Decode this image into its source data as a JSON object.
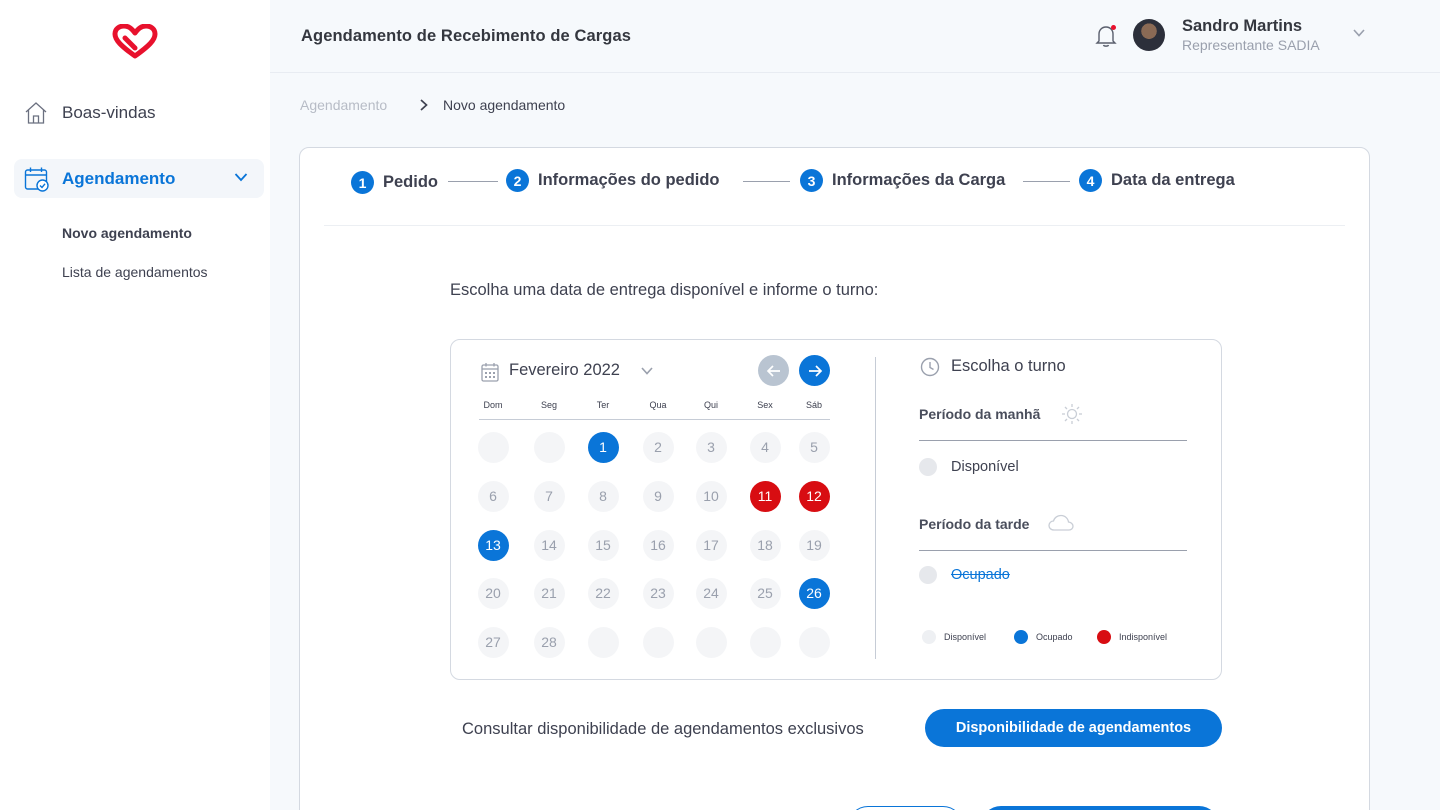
{
  "header": {
    "title": "Agendamento de Recebimento de Cargas",
    "user_name": "Sandro Martins",
    "user_role": "Representante SADIA"
  },
  "sidebar": {
    "items": [
      {
        "label": "Boas-vindas",
        "icon": "home-icon"
      },
      {
        "label": "Agendamento",
        "icon": "calendar-check-icon",
        "active": true,
        "children": [
          {
            "label": "Novo agendamento",
            "active": true
          },
          {
            "label": "Lista de agendamentos"
          }
        ]
      }
    ]
  },
  "breadcrumb": [
    "Agendamento",
    "Novo agendamento"
  ],
  "steps": [
    {
      "num": "1",
      "label": "Pedido"
    },
    {
      "num": "2",
      "label": "Informações do pedido"
    },
    {
      "num": "3",
      "label": "Informações da Carga"
    },
    {
      "num": "4",
      "label": "Data da entrega"
    }
  ],
  "instruction": "Escolha uma data de entrega disponível e informe o turno:",
  "calendar": {
    "month": "Fevereiro 2022",
    "weekdays": [
      "Dom",
      "Seg",
      "Ter",
      "Qua",
      "Qui",
      "Sex",
      "Sáb"
    ],
    "blue_days": [
      1,
      13,
      26
    ],
    "red_days": [
      11,
      12
    ]
  },
  "turno": {
    "title": "Escolha o turno",
    "morning_label": "Período da manhã",
    "morning_option": "Disponível",
    "afternoon_label": "Período da tarde",
    "afternoon_option": "Ocupado",
    "legend": [
      "Disponível",
      "Ocupado",
      "Indisponível"
    ]
  },
  "consult": {
    "text": "Consultar disponibilidade de agendamentos exclusivos",
    "button": "Disponibilidade de agendamentos"
  },
  "colors": {
    "accent": "#0a75d8",
    "danger": "#d80d12",
    "logo": "#e8112d"
  }
}
